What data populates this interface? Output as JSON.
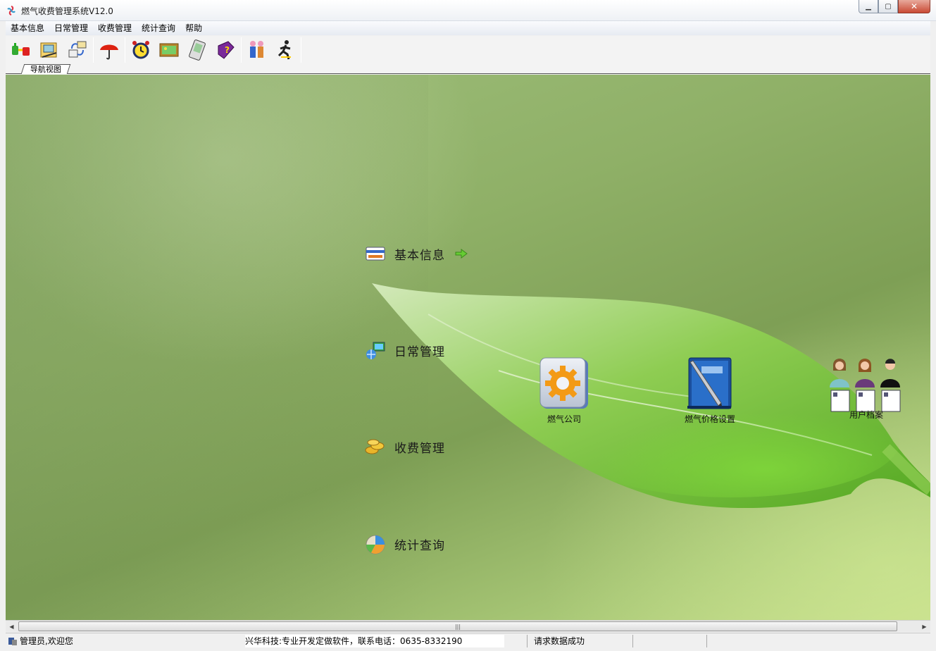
{
  "window": {
    "title": "燃气收费管理系统V12.0"
  },
  "menu": [
    "基本信息",
    "日常管理",
    "收费管理",
    "统计查询",
    "帮助"
  ],
  "toolbar_icons": [
    "connect-icon",
    "folder-icon",
    "transfer-icon",
    "umbrella-icon",
    "alarm-clock-icon",
    "picture-icon",
    "pda-icon",
    "help-book-icon",
    "users-icon",
    "exit-runner-icon"
  ],
  "tab": {
    "label": "导航视图"
  },
  "nav": [
    {
      "label": "基本信息"
    },
    {
      "label": "日常管理"
    },
    {
      "label": "收费管理"
    },
    {
      "label": "统计查询"
    }
  ],
  "functions": [
    {
      "label": "燃气公司"
    },
    {
      "label": "燃气价格设置"
    },
    {
      "label": "用户档案"
    }
  ],
  "status": {
    "user": "管理员,欢迎您",
    "company": "兴华科技:专业开发定做软件，联系电话：0635-8332190",
    "message": "请求数据成功"
  },
  "colors": {
    "leaf": "#6fbe2e",
    "background": "#8fb067"
  }
}
